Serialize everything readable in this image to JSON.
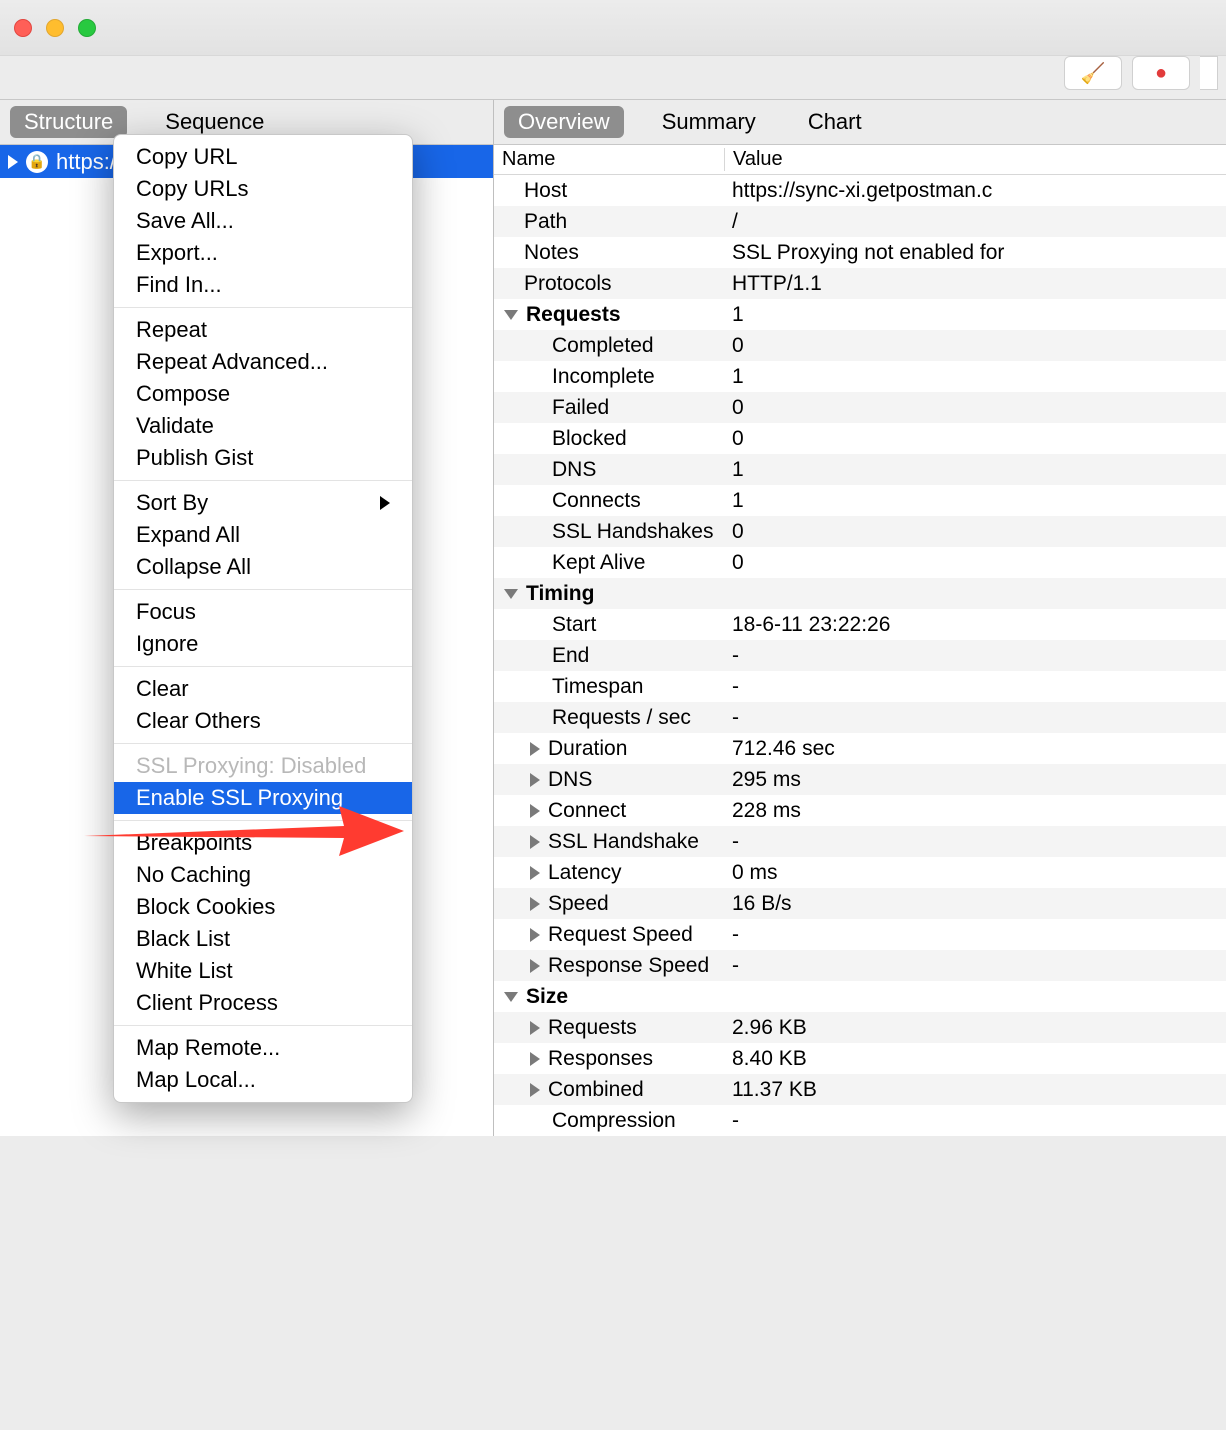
{
  "left_tabs": {
    "structure": "Structure",
    "sequence": "Sequence"
  },
  "right_tabs": {
    "overview": "Overview",
    "summary": "Summary",
    "chart": "Chart"
  },
  "host_row": "https://sync-xi.getpostman.com",
  "context_menu": {
    "copy_url": "Copy URL",
    "copy_urls": "Copy URLs",
    "save_all": "Save All...",
    "export": "Export...",
    "find_in": "Find In...",
    "repeat": "Repeat",
    "repeat_adv": "Repeat Advanced...",
    "compose": "Compose",
    "validate": "Validate",
    "publish_gist": "Publish Gist",
    "sort_by": "Sort By",
    "expand_all": "Expand All",
    "collapse_all": "Collapse All",
    "focus": "Focus",
    "ignore": "Ignore",
    "clear": "Clear",
    "clear_others": "Clear Others",
    "ssl_disabled": "SSL Proxying: Disabled",
    "enable_ssl": "Enable SSL Proxying",
    "breakpoints": "Breakpoints",
    "no_caching": "No Caching",
    "block_cookies": "Block Cookies",
    "black_list": "Black List",
    "white_list": "White List",
    "client_process": "Client Process",
    "map_remote": "Map Remote...",
    "map_local": "Map Local..."
  },
  "overview_headers": {
    "name": "Name",
    "value": "Value"
  },
  "details": {
    "host_k": "Host",
    "host_v": "https://sync-xi.getpostman.c",
    "path_k": "Path",
    "path_v": "/",
    "notes_k": "Notes",
    "notes_v": "SSL Proxying not enabled for",
    "proto_k": "Protocols",
    "proto_v": "HTTP/1.1",
    "requests_k": "Requests",
    "requests_v": "1",
    "completed_k": "Completed",
    "completed_v": "0",
    "incomplete_k": "Incomplete",
    "incomplete_v": "1",
    "failed_k": "Failed",
    "failed_v": "0",
    "blocked_k": "Blocked",
    "blocked_v": "0",
    "dns_k": "DNS",
    "dns_v": "1",
    "connects_k": "Connects",
    "connects_v": "1",
    "sslhs_k": "SSL Handshakes",
    "sslhs_v": "0",
    "keptalive_k": "Kept Alive",
    "keptalive_v": "0",
    "timing_k": "Timing",
    "start_k": "Start",
    "start_v": "18-6-11 23:22:26",
    "end_k": "End",
    "end_v": "-",
    "timespan_k": "Timespan",
    "timespan_v": "-",
    "reqsec_k": "Requests / sec",
    "reqsec_v": "-",
    "duration_k": "Duration",
    "duration_v": "712.46 sec",
    "dns2_k": "DNS",
    "dns2_v": "295 ms",
    "connect_k": "Connect",
    "connect_v": "228 ms",
    "sslhs2_k": "SSL Handshake",
    "sslhs2_v": "-",
    "latency_k": "Latency",
    "latency_v": "0 ms",
    "speed_k": "Speed",
    "speed_v": "16 B/s",
    "reqspeed_k": "Request Speed",
    "reqspeed_v": "-",
    "respspeed_k": "Response Speed",
    "respspeed_v": "-",
    "size_k": "Size",
    "sreq_k": "Requests",
    "sreq_v": "2.96 KB",
    "sresp_k": "Responses",
    "sresp_v": "8.40 KB",
    "scomb_k": "Combined",
    "scomb_v": "11.37 KB",
    "scomp_k": "Compression",
    "scomp_v": "-"
  }
}
